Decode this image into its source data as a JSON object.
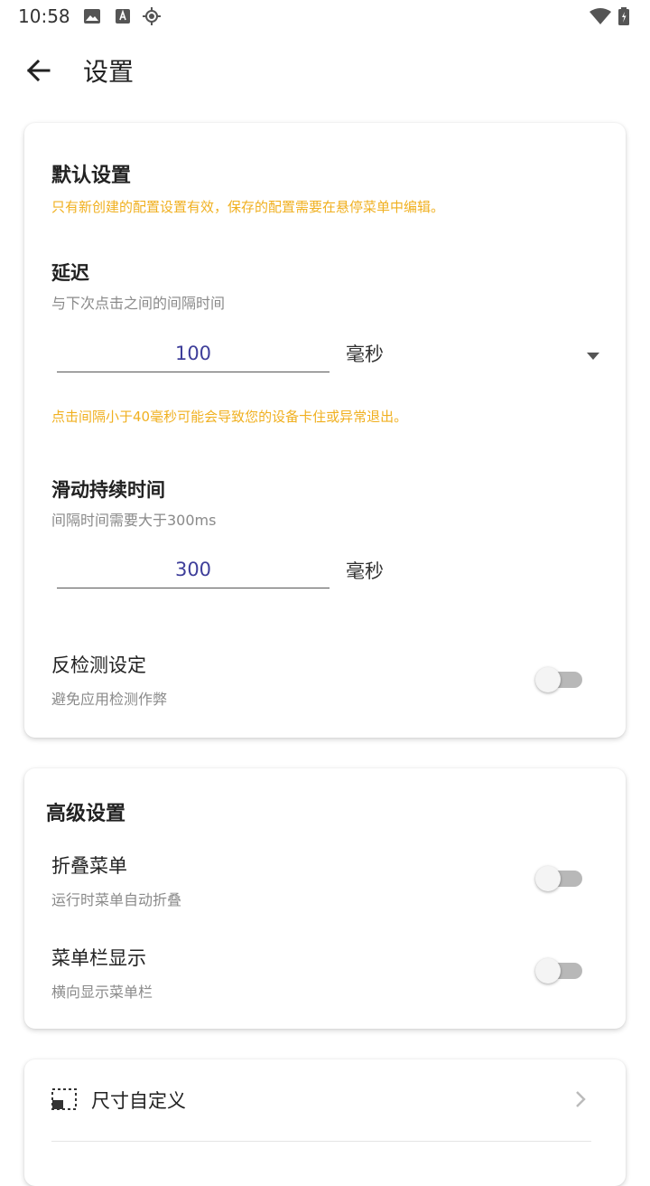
{
  "status_bar": {
    "time": "10:58",
    "icons": [
      "image-icon",
      "text-box-icon",
      "crosshair-icon",
      "wifi-icon",
      "battery-icon"
    ]
  },
  "app_bar": {
    "title": "设置",
    "back_icon": "arrow-left-icon"
  },
  "default_settings": {
    "title": "默认设置",
    "note": "只有新创建的配置设置有效，保存的配置需要在悬停菜单中编辑。",
    "delay": {
      "title": "延迟",
      "subtitle": "与下次点击之间的间隔时间",
      "value": "100",
      "unit": "毫秒",
      "warning": "点击间隔小于40毫秒可能会导致您的设备卡住或异常退出。"
    },
    "swipe_duration": {
      "title": "滑动持续时间",
      "subtitle": "间隔时间需要大于300ms",
      "value": "300",
      "unit": "毫秒"
    },
    "anti_detect": {
      "title": "反检测设定",
      "subtitle": "避免应用检测作弊",
      "enabled": false
    }
  },
  "advanced_settings": {
    "title": "高级设置",
    "fold_menu": {
      "title": "折叠菜单",
      "subtitle": "运行时菜单自动折叠",
      "enabled": false
    },
    "menu_bar": {
      "title": "菜单栏显示",
      "subtitle": "横向显示菜单栏",
      "enabled": false
    }
  },
  "size_custom": {
    "label": "尺寸自定义"
  },
  "colors": {
    "warning": "#f0b020",
    "input_text": "#3e3e9a",
    "toggle_track": "#b8b8b8"
  }
}
